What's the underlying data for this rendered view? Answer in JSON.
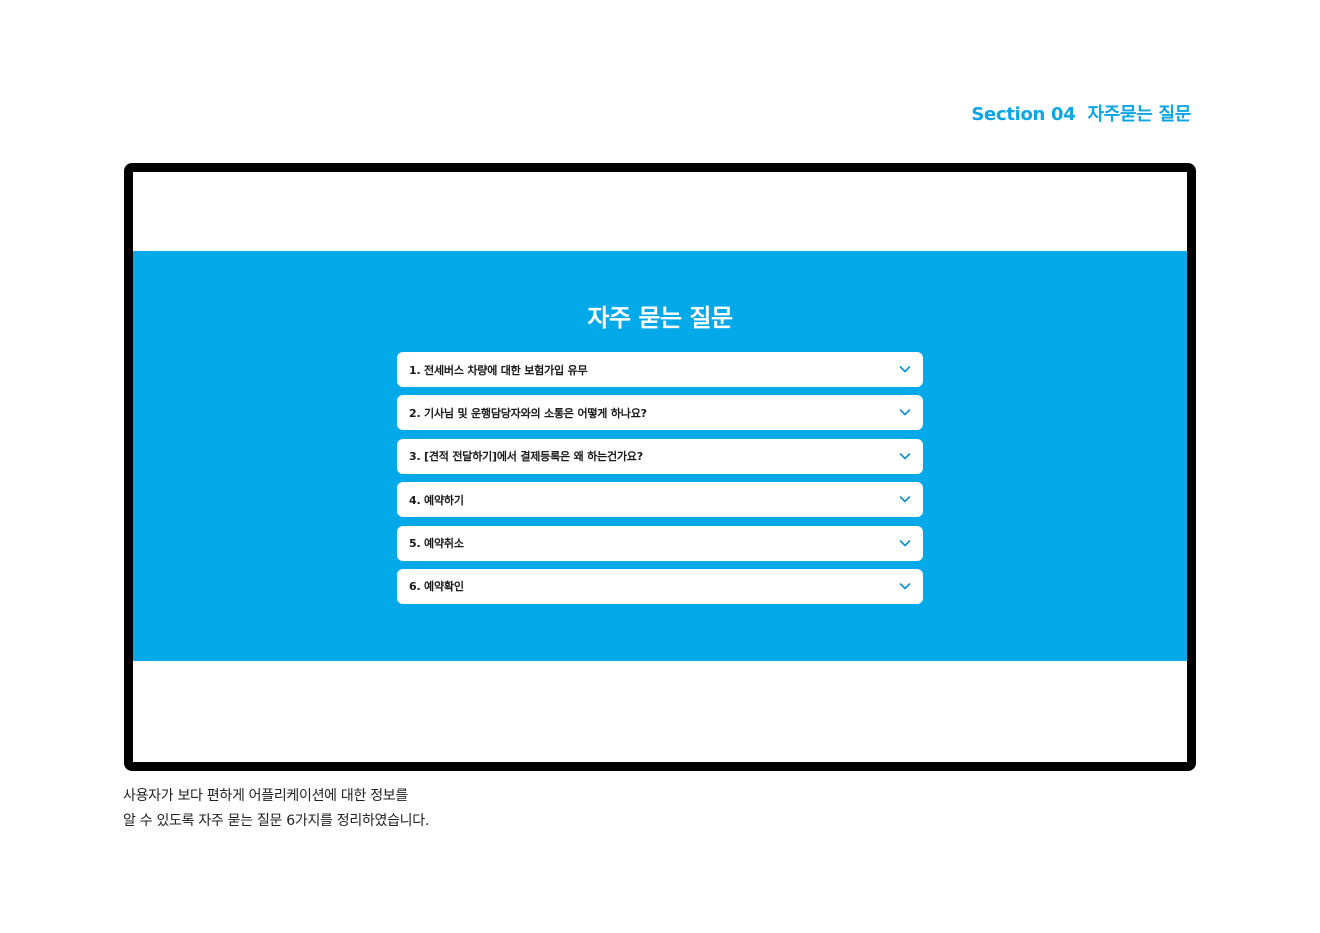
{
  "header": {
    "section_number": "Section 04",
    "section_title": "자주묻는 질문"
  },
  "screen": {
    "faq": {
      "title": "자주 묻는 질문",
      "items": [
        {
          "question": "1. 전세버스 차량에 대한 보험가입 유무",
          "icon": "chevron-down-icon"
        },
        {
          "question": "2. 기사님 및 운행담당자와의 소통은 어떻게 하나요?",
          "icon": "chevron-down-icon"
        },
        {
          "question": "3. [견적 전달하기]에서 결제등록은 왜 하는건가요?",
          "icon": "chevron-down-icon"
        },
        {
          "question": "4. 예약하기",
          "icon": "chevron-down-icon"
        },
        {
          "question": "5. 예약취소",
          "icon": "chevron-down-icon"
        },
        {
          "question": "6. 예약확인",
          "icon": "chevron-down-icon"
        }
      ]
    }
  },
  "caption": {
    "line1": "사용자가 보다 편하게 어플리케이션에 대한 정보를",
    "line2": "알 수 있도록 자주 묻는 질문 6가지를 정리하였습니다."
  },
  "colors": {
    "accent": "#03a9e8",
    "frame": "#000000",
    "card": "#ffffff",
    "chevron": "#0a8fd1"
  }
}
